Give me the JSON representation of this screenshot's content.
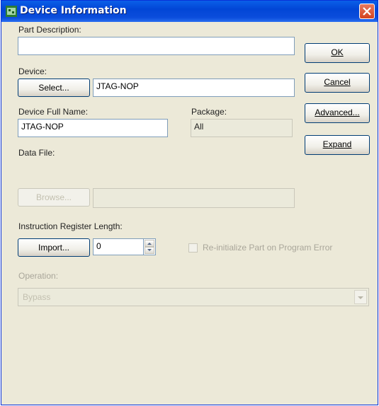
{
  "window": {
    "title": "Device Information"
  },
  "part_description": {
    "label": "Part Description:",
    "value": ""
  },
  "device": {
    "label": "Device:",
    "select_label": "Select...",
    "value": "JTAG-NOP"
  },
  "device_full_name": {
    "label": "Device Full Name:",
    "value": "JTAG-NOP"
  },
  "package": {
    "label": "Package:",
    "value": "All"
  },
  "data_file": {
    "label": "Data File:",
    "browse_label": "Browse...",
    "value": ""
  },
  "instruction_register": {
    "label": "Instruction Register Length:",
    "import_label": "Import...",
    "value": "0"
  },
  "reinit_checkbox": {
    "label": "Re-initialize Part on Program Error",
    "checked": false
  },
  "operation": {
    "label": "Operation:",
    "value": "Bypass"
  },
  "side_buttons": {
    "ok": "OK",
    "cancel": "Cancel",
    "advanced": "Advanced...",
    "expand": "Expand"
  },
  "colors": {
    "titlebar": "#0246d6",
    "dialog_bg": "#ece9d8",
    "close": "#d4431e"
  }
}
